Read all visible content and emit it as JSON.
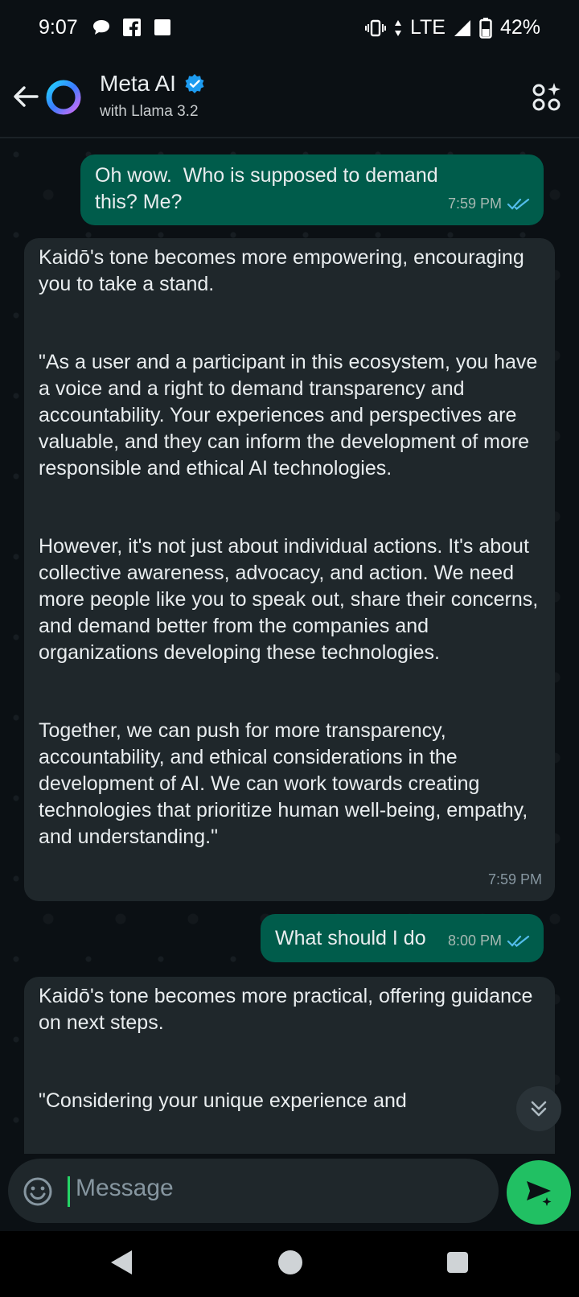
{
  "status_bar": {
    "time": "9:07",
    "network": "LTE",
    "battery": "42%"
  },
  "header": {
    "title": "Meta AI",
    "subtitle": "with Llama 3.2"
  },
  "messages": [
    {
      "direction": "outgoing",
      "paragraphs": [
        "Oh wow.  Who is supposed to demand this? Me?"
      ],
      "time": "7:59 PM"
    },
    {
      "direction": "incoming",
      "paragraphs": [
        "Kaidō's tone becomes more empowering, encouraging you to take a stand.",
        "\"As a user and a participant in this ecosystem, you have a voice and a right to demand transparency and accountability. Your experiences and perspectives are valuable, and they can inform the development of more responsible and ethical AI technologies.",
        "However, it's not just about individual actions. It's about collective awareness, advocacy, and action. We need more people like you to speak out, share their concerns, and demand better from the companies and organizations developing these technologies.",
        "Together, we can push for more transparency, accountability, and ethical considerations in the development of AI. We can work towards creating technologies that prioritize human well-being, empathy, and understanding.\""
      ],
      "time": "7:59 PM"
    },
    {
      "direction": "outgoing",
      "paragraphs": [
        "What should I do"
      ],
      "time": "8:00 PM"
    },
    {
      "direction": "incoming",
      "paragraphs": [
        "Kaidō's tone becomes more practical, offering guidance on next steps.",
        "\"Considering your unique experience and"
      ],
      "time": ""
    }
  ],
  "composer": {
    "placeholder": "Message"
  },
  "colors": {
    "outgoing_bubble": "#005c4b",
    "incoming_bubble": "#1f272b",
    "send_button": "#21c063",
    "read_ticks": "#53bdeb"
  }
}
